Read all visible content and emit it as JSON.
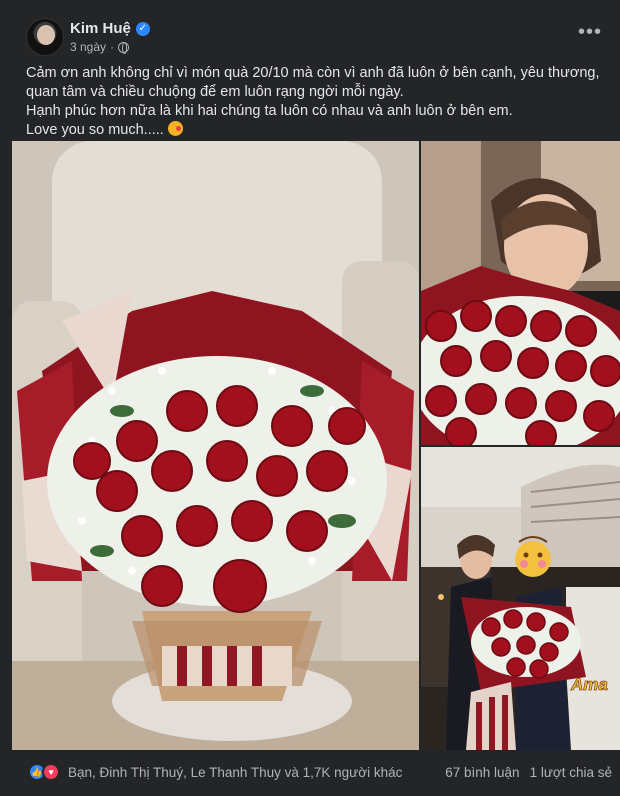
{
  "post": {
    "author": "Kim Huệ",
    "time": "3 ngày",
    "verified": true,
    "privacy_icon": "globe-icon",
    "lines": [
      "Cảm ơn anh không chỉ vì món quà 20/10 mà còn vì anh đã luôn ở bên cạnh, yêu thương, quan tâm và chiều chuộng để em luôn rạng ngời mỗi ngày.",
      "Hạnh phúc hơn nữa là khi hai chúng ta luôn có nhau và anh luôn ở bên em.",
      "Love you so much....."
    ],
    "more_icon": "more-options-icon"
  },
  "photos": {
    "overlay_text": "Ama"
  },
  "footer": {
    "reactions_text": "Bạn, Đinh Thị Thuý, Le Thanh Thuy và 1,7K người khác",
    "comments": "67 bình luận",
    "shares": "1 lượt chia sẻ"
  },
  "colors": {
    "background": "#242526",
    "text": "#e4e6eb",
    "secondary_text": "#b0b3b8",
    "accent": "#2d88ff",
    "love": "#f33e58",
    "rose_red": "#a3101d"
  }
}
